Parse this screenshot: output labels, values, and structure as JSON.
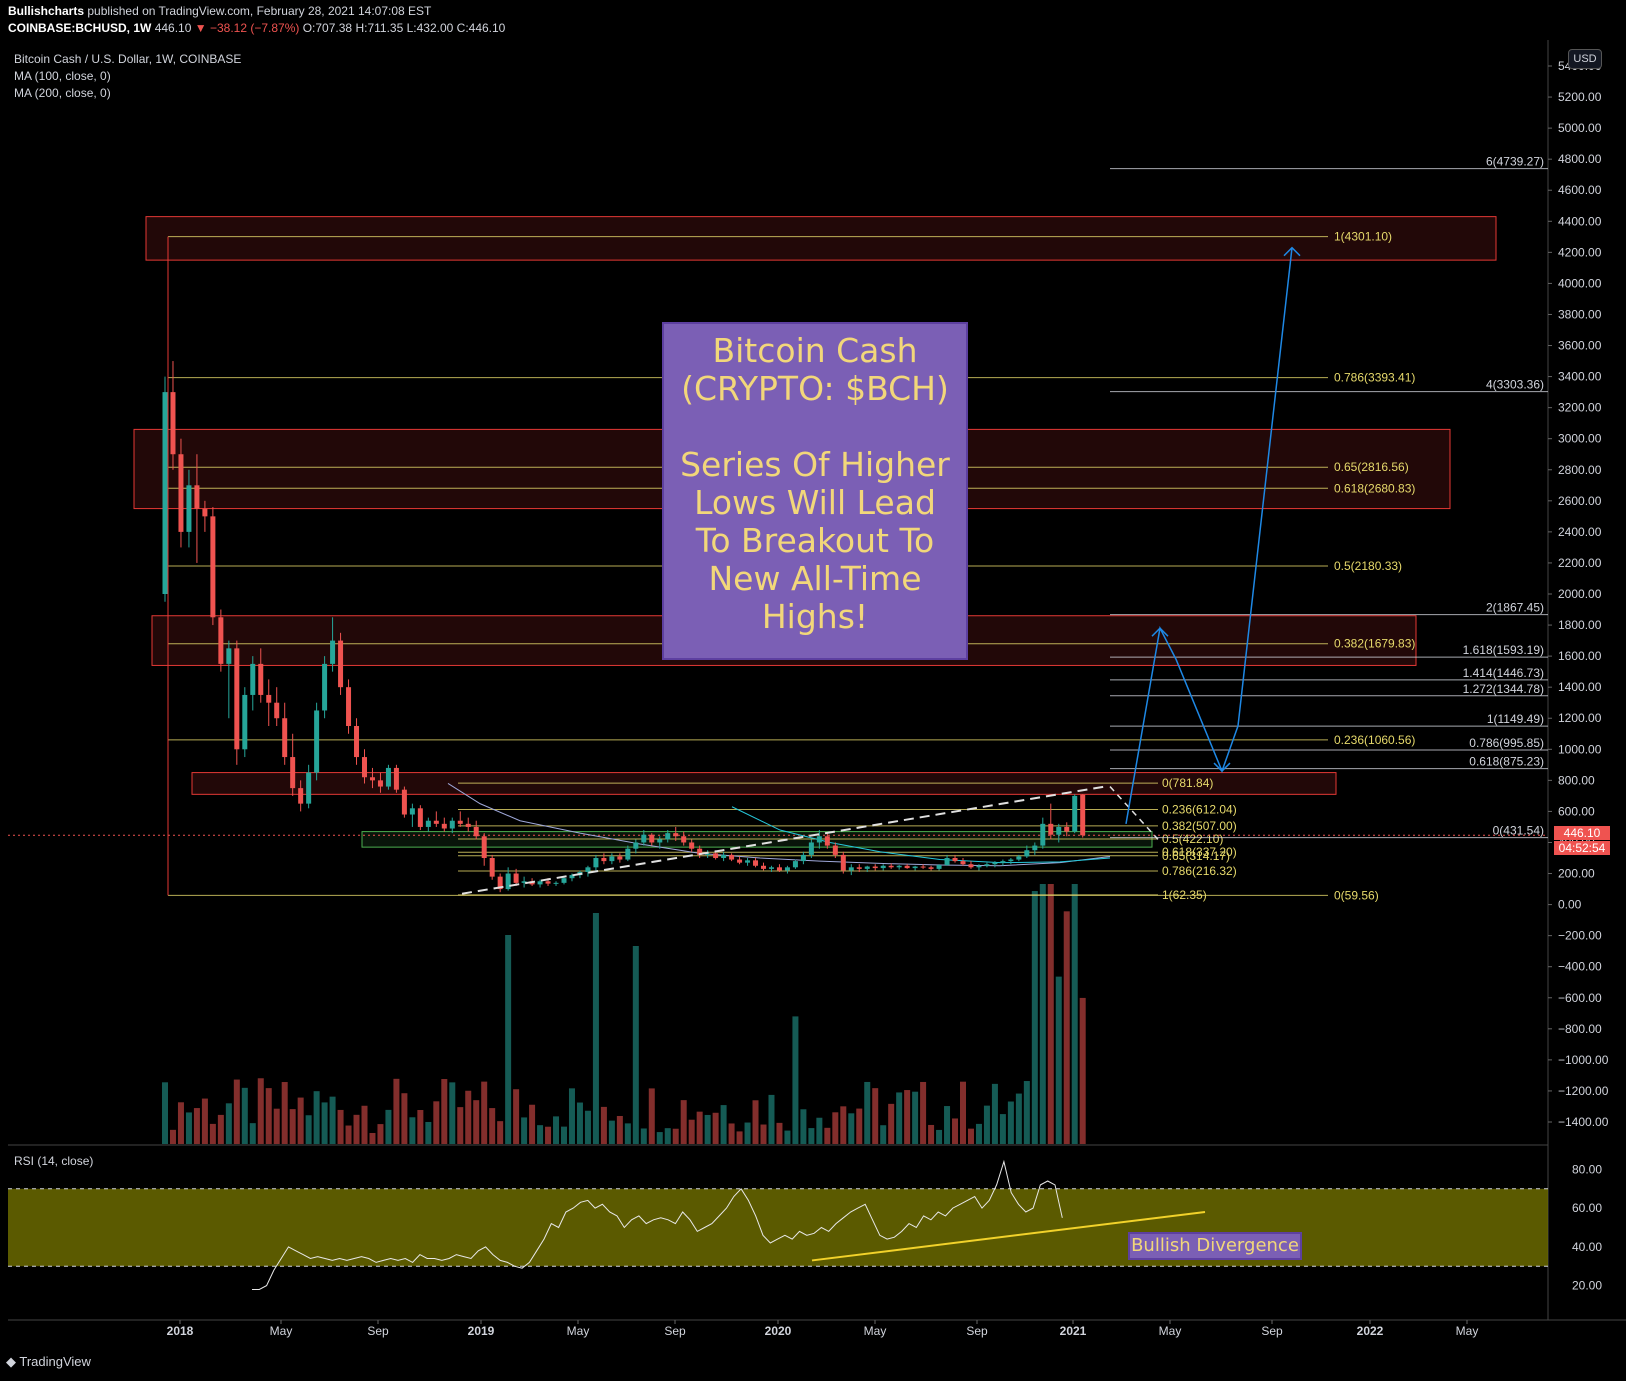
{
  "header": {
    "publisher": "Bullishcharts",
    "published_text": "published on TradingView.com, February 28, 2021 14:07:08 EST",
    "symbol": "COINBASE:BCHUSD, 1W",
    "price": "446.10",
    "change": "−38.12 (−7.87%)",
    "ohlc": [
      "O:707.38",
      "H:711.35",
      "L:432.00",
      "C:446.10"
    ]
  },
  "legend": {
    "title": "Bitcoin Cash / U.S. Dollar, 1W, COINBASE",
    "ma100": "MA (100, close, 0)",
    "ma200": "MA (200, close, 0)",
    "rsi": "RSI (14, close)"
  },
  "usd_label": "USD",
  "price_tag": {
    "price": "446.10",
    "countdown": "04:52:54"
  },
  "annotation": {
    "lines": [
      "Bitcoin Cash",
      "(CRYPTO: $BCH)",
      "",
      "Series Of Higher",
      "Lows Will Lead",
      "To Breakout To",
      "New All-Time",
      "Highs!"
    ],
    "bullish": "Bullish Divergence"
  },
  "footer": {
    "brand": "TradingView"
  },
  "colors": {
    "up": "#26a69a",
    "down": "#ef5350",
    "fib": "#e6d96b",
    "zone": "#e53935",
    "arrow": "#1e88e5",
    "rsi_band": "#6b6a00",
    "annotation_bg": "#7b5fb5"
  },
  "chart_data": {
    "type": "candlestick",
    "title": "Bitcoin Cash / U.S. Dollar, 1W, COINBASE",
    "price_axis": {
      "min": -1400,
      "max": 5400,
      "step": 200,
      "ticks": [
        "5400.00",
        "5200.00",
        "5000.00",
        "4800.00",
        "4600.00",
        "4400.00",
        "4200.00",
        "4000.00",
        "3800.00",
        "3600.00",
        "3400.00",
        "3200.00",
        "3000.00",
        "2800.00",
        "2600.00",
        "2400.00",
        "2200.00",
        "2000.00",
        "1800.00",
        "1600.00",
        "1400.00",
        "1200.00",
        "1000.00",
        "800.00",
        "600.00",
        "400.00",
        "200.00",
        "0.00",
        "−200.00",
        "−400.00",
        "−600.00",
        "−800.00",
        "−1000.00",
        "−1200.00",
        "−1400.00"
      ]
    },
    "time_axis": [
      "2018",
      "May",
      "Sep",
      "2019",
      "May",
      "Sep",
      "2020",
      "May",
      "Sep",
      "2021",
      "May",
      "Sep",
      "2022",
      "May"
    ],
    "fib_retracement_major": [
      {
        "label": "1(4301.10)",
        "value": 4301.1
      },
      {
        "label": "0.786(3393.41)",
        "value": 3393.41
      },
      {
        "label": "0.65(2816.56)",
        "value": 2816.56
      },
      {
        "label": "0.618(2680.83)",
        "value": 2680.83
      },
      {
        "label": "0.5(2180.33)",
        "value": 2180.33
      },
      {
        "label": "0.382(1679.83)",
        "value": 1679.83
      },
      {
        "label": "0.236(1060.56)",
        "value": 1060.56
      },
      {
        "label": "0(59.56)",
        "value": 59.56
      }
    ],
    "fib_retracement_minor": [
      {
        "label": "0(781.84)",
        "value": 781.84
      },
      {
        "label": "0.236(612.04)",
        "value": 612.04
      },
      {
        "label": "0.382(507.00)",
        "value": 507.0
      },
      {
        "label": "0.5(422.10)",
        "value": 422.1
      },
      {
        "label": "0.618(337.20)",
        "value": 337.2
      },
      {
        "label": "0.65(314.17)",
        "value": 314.17
      },
      {
        "label": "0.786(216.32)",
        "value": 216.32
      },
      {
        "label": "1(62.35)",
        "value": 62.35
      }
    ],
    "fib_extension": [
      {
        "label": "6(4739.27)",
        "value": 4739.27
      },
      {
        "label": "4(3303.36)",
        "value": 3303.36
      },
      {
        "label": "2(1867.45)",
        "value": 1867.45
      },
      {
        "label": "1.618(1593.19)",
        "value": 1593.19
      },
      {
        "label": "1.414(1446.73)",
        "value": 1446.73
      },
      {
        "label": "1.272(1344.78)",
        "value": 1344.78
      },
      {
        "label": "1(1149.49)",
        "value": 1149.49
      },
      {
        "label": "0.786(995.85)",
        "value": 995.85
      },
      {
        "label": "0.618(875.23)",
        "value": 875.23
      },
      {
        "label": "0(431.54)",
        "value": 431.54
      }
    ],
    "resistance_zones": [
      {
        "from": 4150,
        "to": 4430
      },
      {
        "from": 2550,
        "to": 3060
      },
      {
        "from": 1540,
        "to": 1860
      },
      {
        "from": 710,
        "to": 850
      }
    ],
    "support_zone": {
      "from": 370,
      "to": 470
    },
    "current_price": 446.1,
    "rsi_axis": {
      "ticks": [
        "80.00",
        "60.00",
        "40.00",
        "20.00"
      ],
      "min": 10,
      "max": 90,
      "overbought": 70,
      "oversold": 30
    },
    "rsi_divergence": {
      "from": 33,
      "to": 58
    },
    "candles": [
      [
        1,
        2000,
        3400,
        1950,
        3300
      ],
      [
        2,
        3300,
        3500,
        2800,
        2900
      ],
      [
        3,
        2900,
        3000,
        2300,
        2400
      ],
      [
        4,
        2400,
        2800,
        2300,
        2700
      ],
      [
        5,
        2700,
        2900,
        2200,
        2550
      ],
      [
        6,
        2550,
        2600,
        2400,
        2500
      ],
      [
        7,
        2500,
        2560,
        1800,
        1850
      ],
      [
        8,
        1850,
        1900,
        1500,
        1550
      ],
      [
        9,
        1550,
        1700,
        1200,
        1650
      ],
      [
        10,
        1650,
        1700,
        900,
        1000
      ],
      [
        11,
        1000,
        1400,
        950,
        1350
      ],
      [
        12,
        1350,
        1600,
        1250,
        1550
      ],
      [
        13,
        1550,
        1650,
        1300,
        1350
      ],
      [
        14,
        1350,
        1450,
        1150,
        1300
      ],
      [
        15,
        1300,
        1400,
        1150,
        1200
      ],
      [
        16,
        1200,
        1300,
        900,
        950
      ],
      [
        17,
        950,
        1100,
        700,
        750
      ],
      [
        18,
        750,
        800,
        600,
        650
      ],
      [
        19,
        650,
        900,
        620,
        850
      ],
      [
        20,
        850,
        1300,
        800,
        1250
      ],
      [
        21,
        1250,
        1600,
        1200,
        1550
      ],
      [
        22,
        1550,
        1850,
        1500,
        1700
      ],
      [
        23,
        1700,
        1750,
        1350,
        1400
      ],
      [
        24,
        1400,
        1450,
        1100,
        1150
      ],
      [
        25,
        1150,
        1200,
        900,
        950
      ],
      [
        26,
        950,
        1000,
        780,
        820
      ],
      [
        27,
        820,
        880,
        750,
        800
      ],
      [
        28,
        800,
        850,
        720,
        760
      ],
      [
        29,
        760,
        900,
        740,
        880
      ],
      [
        30,
        880,
        900,
        720,
        740
      ],
      [
        31,
        740,
        760,
        560,
        580
      ],
      [
        32,
        580,
        650,
        500,
        620
      ],
      [
        33,
        620,
        640,
        480,
        500
      ],
      [
        34,
        500,
        560,
        470,
        540
      ],
      [
        35,
        540,
        600,
        500,
        520
      ],
      [
        36,
        520,
        560,
        470,
        490
      ],
      [
        37,
        490,
        560,
        460,
        540
      ],
      [
        38,
        540,
        600,
        500,
        520
      ],
      [
        39,
        520,
        560,
        470,
        500
      ],
      [
        40,
        500,
        540,
        420,
        440
      ],
      [
        41,
        440,
        460,
        250,
        300
      ],
      [
        42,
        300,
        320,
        160,
        180
      ],
      [
        43,
        180,
        200,
        80,
        100
      ],
      [
        44,
        100,
        240,
        90,
        200
      ],
      [
        45,
        200,
        230,
        120,
        140
      ],
      [
        46,
        140,
        180,
        110,
        150
      ],
      [
        47,
        150,
        170,
        120,
        130
      ],
      [
        48,
        130,
        160,
        110,
        150
      ],
      [
        49,
        150,
        170,
        120,
        135
      ],
      [
        50,
        135,
        150,
        120,
        140
      ],
      [
        51,
        140,
        180,
        130,
        170
      ],
      [
        52,
        170,
        200,
        150,
        190
      ],
      [
        53,
        190,
        220,
        170,
        210
      ],
      [
        54,
        210,
        250,
        180,
        240
      ],
      [
        55,
        240,
        320,
        220,
        300
      ],
      [
        56,
        300,
        330,
        260,
        280
      ],
      [
        57,
        280,
        330,
        260,
        310
      ],
      [
        58,
        310,
        330,
        270,
        290
      ],
      [
        59,
        290,
        380,
        280,
        360
      ],
      [
        60,
        360,
        420,
        330,
        400
      ],
      [
        61,
        400,
        480,
        380,
        450
      ],
      [
        62,
        450,
        460,
        380,
        400
      ],
      [
        63,
        400,
        440,
        360,
        420
      ],
      [
        64,
        420,
        480,
        400,
        460
      ],
      [
        65,
        460,
        500,
        410,
        440
      ],
      [
        66,
        440,
        470,
        380,
        400
      ],
      [
        67,
        400,
        420,
        340,
        360
      ],
      [
        68,
        360,
        380,
        300,
        320
      ],
      [
        69,
        320,
        350,
        300,
        330
      ],
      [
        70,
        330,
        350,
        290,
        300
      ],
      [
        71,
        300,
        340,
        280,
        320
      ],
      [
        72,
        320,
        330,
        280,
        290
      ],
      [
        73,
        290,
        310,
        260,
        270
      ],
      [
        74,
        270,
        300,
        250,
        285
      ],
      [
        75,
        285,
        300,
        240,
        250
      ],
      [
        76,
        250,
        270,
        220,
        230
      ],
      [
        77,
        230,
        250,
        210,
        240
      ],
      [
        78,
        240,
        260,
        210,
        220
      ],
      [
        79,
        220,
        250,
        200,
        240
      ],
      [
        80,
        240,
        290,
        230,
        280
      ],
      [
        81,
        280,
        340,
        260,
        320
      ],
      [
        82,
        320,
        420,
        300,
        400
      ],
      [
        83,
        400,
        480,
        360,
        440
      ],
      [
        84,
        440,
        460,
        360,
        380
      ],
      [
        85,
        380,
        400,
        300,
        320
      ],
      [
        86,
        320,
        340,
        200,
        220
      ],
      [
        87,
        220,
        260,
        190,
        240
      ],
      [
        88,
        240,
        260,
        210,
        230
      ],
      [
        89,
        230,
        250,
        210,
        245
      ],
      [
        90,
        245,
        260,
        220,
        235
      ],
      [
        91,
        235,
        260,
        220,
        250
      ],
      [
        92,
        250,
        265,
        230,
        240
      ],
      [
        93,
        240,
        255,
        225,
        250
      ],
      [
        94,
        250,
        260,
        230,
        235
      ],
      [
        95,
        235,
        250,
        220,
        245
      ],
      [
        96,
        245,
        260,
        230,
        240
      ],
      [
        97,
        240,
        250,
        220,
        230
      ],
      [
        98,
        230,
        260,
        220,
        255
      ],
      [
        99,
        255,
        320,
        250,
        300
      ],
      [
        100,
        300,
        320,
        270,
        280
      ],
      [
        101,
        280,
        300,
        250,
        260
      ],
      [
        102,
        260,
        280,
        230,
        240
      ],
      [
        103,
        240,
        260,
        220,
        250
      ],
      [
        104,
        250,
        270,
        240,
        260
      ],
      [
        105,
        260,
        280,
        240,
        270
      ],
      [
        106,
        270,
        290,
        250,
        280
      ],
      [
        107,
        280,
        300,
        260,
        290
      ],
      [
        108,
        290,
        320,
        280,
        310
      ],
      [
        109,
        310,
        380,
        300,
        350
      ],
      [
        110,
        350,
        400,
        320,
        380
      ],
      [
        111,
        380,
        560,
        360,
        520
      ],
      [
        112,
        520,
        650,
        420,
        450
      ],
      [
        113,
        450,
        520,
        400,
        500
      ],
      [
        114,
        500,
        530,
        440,
        470
      ],
      [
        115,
        470,
        710,
        460,
        700
      ],
      [
        116,
        707.38,
        711.35,
        432.0,
        446.1
      ]
    ]
  }
}
